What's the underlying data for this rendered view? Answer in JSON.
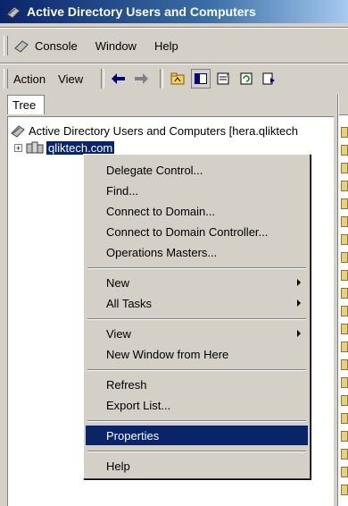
{
  "window": {
    "title": "Active Directory Users and Computers"
  },
  "menubar": {
    "items": [
      {
        "label": "Console"
      },
      {
        "label": "Window"
      },
      {
        "label": "Help"
      }
    ]
  },
  "toolbar": {
    "action_label": "Action",
    "view_label": "View"
  },
  "tree": {
    "tab_label": "Tree",
    "root_label": "Active Directory Users and Computers [hera.qliktech",
    "domain_label": "qliktech.com"
  },
  "context_menu": {
    "delegate_control": "Delegate Control...",
    "find": "Find...",
    "connect_domain": "Connect to Domain...",
    "connect_dc": "Connect to Domain Controller...",
    "operations_masters": "Operations Masters...",
    "new": "New",
    "all_tasks": "All Tasks",
    "view": "View",
    "new_window": "New Window from Here",
    "refresh": "Refresh",
    "export_list": "Export List...",
    "properties": "Properties",
    "help": "Help"
  },
  "colors": {
    "selection": "#0a246a",
    "face": "#d4d0c8",
    "title_start": "#0a246a",
    "title_end": "#a6caf0"
  }
}
